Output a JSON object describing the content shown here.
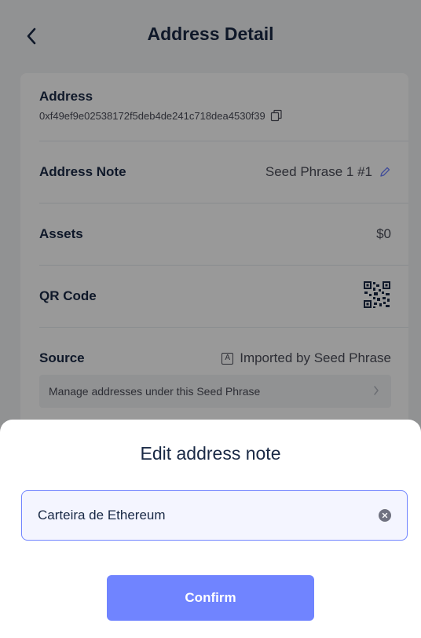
{
  "header": {
    "title": "Address Detail",
    "back_icon": "chevron-left-icon"
  },
  "details": {
    "address_label": "Address",
    "address_value": "0xf49ef9e02538172f5deb4de241c718dea4530f39",
    "note_label": "Address Note",
    "note_value": "Seed Phrase 1 #1",
    "assets_label": "Assets",
    "assets_value": "$0",
    "qr_label": "QR Code",
    "source_label": "Source",
    "source_badge": "A",
    "source_value": "Imported by Seed Phrase",
    "manage_link": "Manage addresses under this Seed Phrase"
  },
  "sheet": {
    "title": "Edit address note",
    "input_value": "Carteira de Ethereum",
    "confirm_label": "Confirm"
  },
  "colors": {
    "accent": "#7084ff",
    "title_text": "#192945",
    "secondary_text": "#4b4d59",
    "background": "#f2f4f5"
  }
}
